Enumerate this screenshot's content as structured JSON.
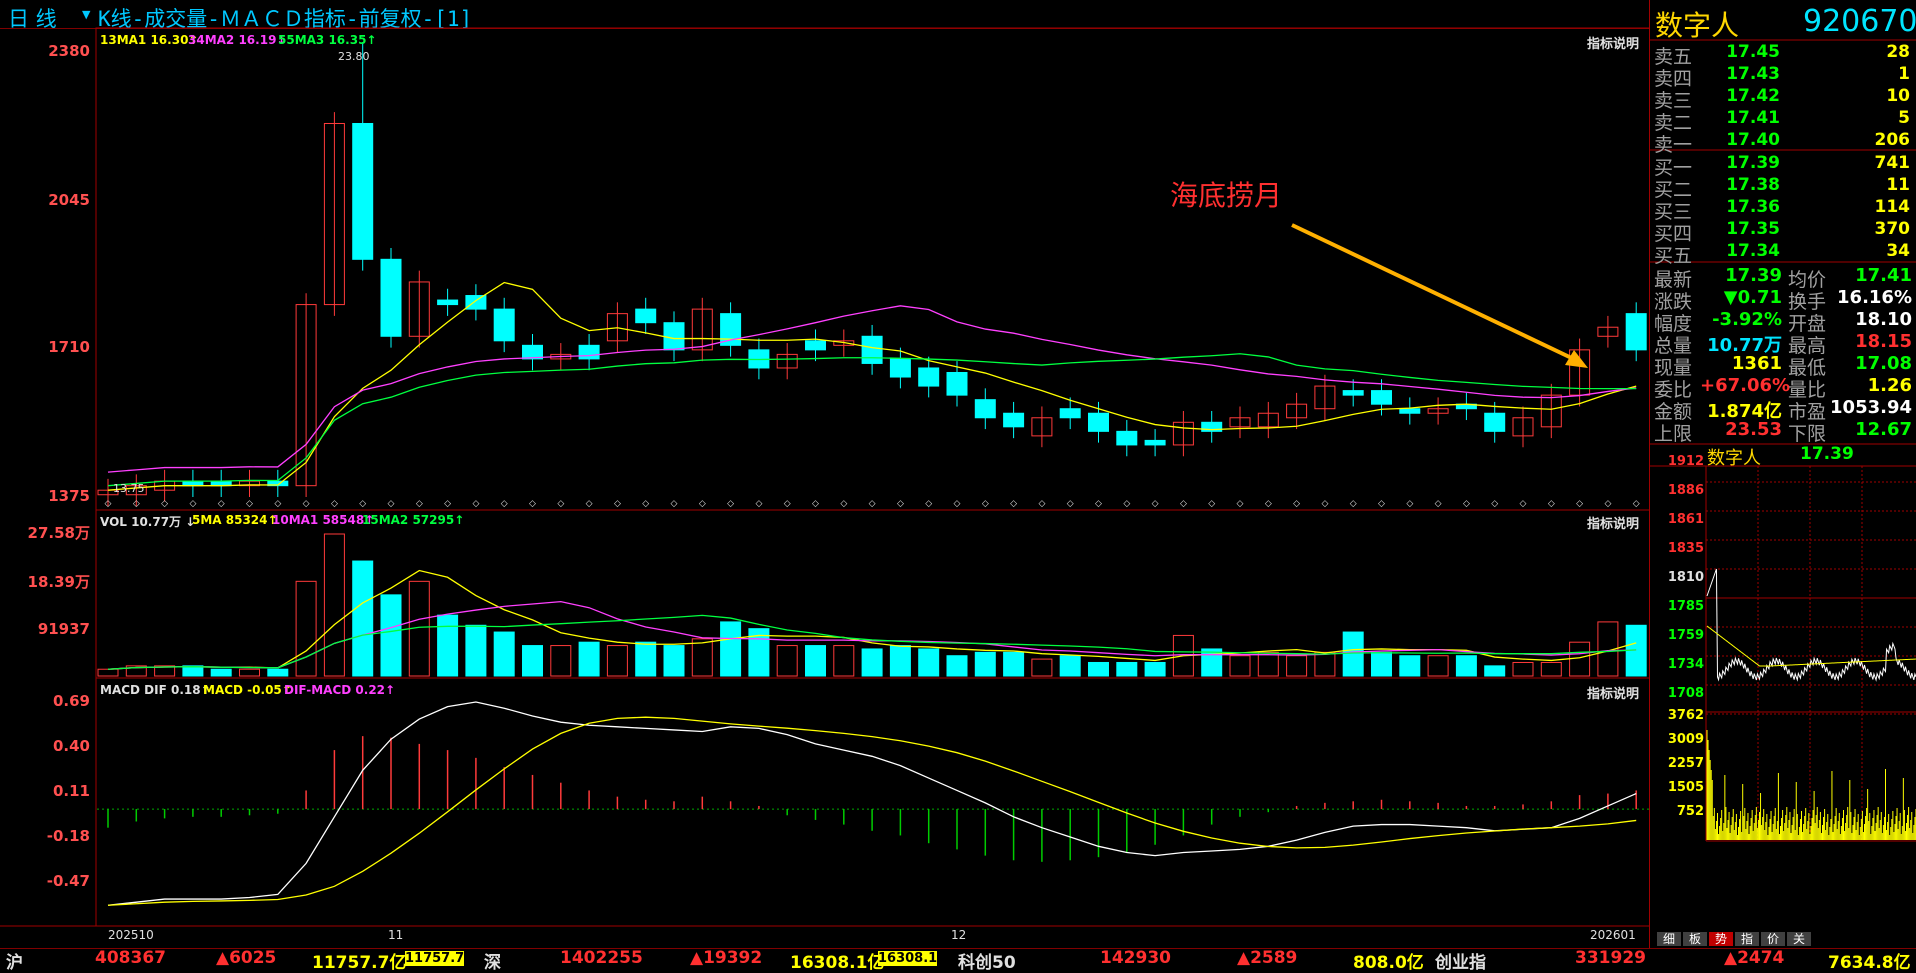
{
  "header": {
    "period": "日 线",
    "title": "K线-成交量-ＭＡＣＤ指标-前复权-[1]"
  },
  "stock": {
    "name": "数字人",
    "code": "920670"
  },
  "annotation": "海底捞月",
  "kline": {
    "y_labels": [
      "2380",
      "2045",
      "1710",
      "1375"
    ],
    "ma_label_prefix": "13MA1 16.30↑",
    "ma2": "34MA2 16.19↓",
    "ma3": "55MA3 16.35↑",
    "high_mark": "23.80",
    "low_mark": "13.75",
    "help": "指标说明"
  },
  "volume": {
    "y_labels": [
      "27.58万",
      "18.39万",
      "91937"
    ],
    "vol": "VOL 10.77万 ↓",
    "ma5": "5MA 85324↑",
    "ma10": "10MA1 58548↑",
    "ma15": "15MA2 57295↑",
    "help": "指标说明"
  },
  "macd": {
    "y_labels": [
      "0.69",
      "0.40",
      "0.11",
      "-0.18",
      "-0.47"
    ],
    "dif": "MACD DIF 0.18↑",
    "macd": "MACD -0.05↑",
    "difmacd": "DIF-MACD 0.22↑",
    "help": "指标说明"
  },
  "dates": [
    "202510",
    "11",
    "12",
    "202601"
  ],
  "orderbook": {
    "sell": [
      {
        "label": "卖五",
        "price": "17.45",
        "vol": "28"
      },
      {
        "label": "卖四",
        "price": "17.43",
        "vol": "1"
      },
      {
        "label": "卖三",
        "price": "17.42",
        "vol": "10"
      },
      {
        "label": "卖二",
        "price": "17.41",
        "vol": "5"
      },
      {
        "label": "卖一",
        "price": "17.40",
        "vol": "206"
      }
    ],
    "buy": [
      {
        "label": "买一",
        "price": "17.39",
        "vol": "741"
      },
      {
        "label": "买二",
        "price": "17.38",
        "vol": "11"
      },
      {
        "label": "买三",
        "price": "17.36",
        "vol": "114"
      },
      {
        "label": "买四",
        "price": "17.35",
        "vol": "370"
      },
      {
        "label": "买五",
        "price": "17.34",
        "vol": "34"
      }
    ]
  },
  "stats": [
    {
      "l1": "最新",
      "v1": "17.39",
      "c1": "#00ff00",
      "l2": "均价",
      "v2": "17.41",
      "c2": "#00ff00"
    },
    {
      "l1": "涨跌",
      "v1": "▼0.71",
      "c1": "#00ff00",
      "l2": "换手",
      "v2": "16.16%",
      "c2": "#ffffff"
    },
    {
      "l1": "幅度",
      "v1": "-3.92%",
      "c1": "#00ff00",
      "l2": "开盘",
      "v2": "18.10",
      "c2": "#ffffff"
    },
    {
      "l1": "总量",
      "v1": "10.77万",
      "c1": "#00e5ff",
      "l2": "最高",
      "v2": "18.15",
      "c2": "#ff3030"
    },
    {
      "l1": "现量",
      "v1": "1361",
      "c1": "#ffff00",
      "l2": "最低",
      "v2": "17.08",
      "c2": "#00ff00"
    },
    {
      "l1": "委比",
      "v1": "+67.06%",
      "c1": "#ff3030",
      "l2": "量比",
      "v2": "1.26",
      "c2": "#ffff00"
    },
    {
      "l1": "金额",
      "v1": "1.874亿",
      "c1": "#ffff00",
      "l2": "市盈",
      "v2": "1053.94",
      "c2": "#ffffff"
    },
    {
      "l1": "上限",
      "v1": "23.53",
      "c1": "#ff3030",
      "l2": "下限",
      "v2": "12.67",
      "c2": "#00ff00"
    }
  ],
  "mini": {
    "name": "数字人",
    "price": "17.39",
    "price_labels": [
      "1912",
      "1886",
      "1861",
      "1835",
      "1810",
      "1785",
      "1759",
      "1734",
      "1708"
    ],
    "vol_labels": [
      "3762",
      "3009",
      "2257",
      "1505",
      "752"
    ],
    "tabs": [
      "细",
      "板",
      "势",
      "指",
      "价",
      "关"
    ]
  },
  "bottom": {
    "sh_label": "沪",
    "sh_val": "408367",
    "sh_chg": "▲6025",
    "sh_amt": "11757.7亿",
    "sh_amt2": "11757.7",
    "sz_label": "深",
    "sz_val": "1402255",
    "sz_chg": "▲19392",
    "sz_amt": "16308.1亿",
    "sz_amt2": "16308.1",
    "kc_label": "科创50",
    "kc_val": "142930",
    "kc_chg": "▲2589",
    "kc_amt": "808.0亿",
    "cy_label": "创业指",
    "cy_val": "331929",
    "cy_chg": "▲2474",
    "cy_amt": "7634.8亿"
  }
}
